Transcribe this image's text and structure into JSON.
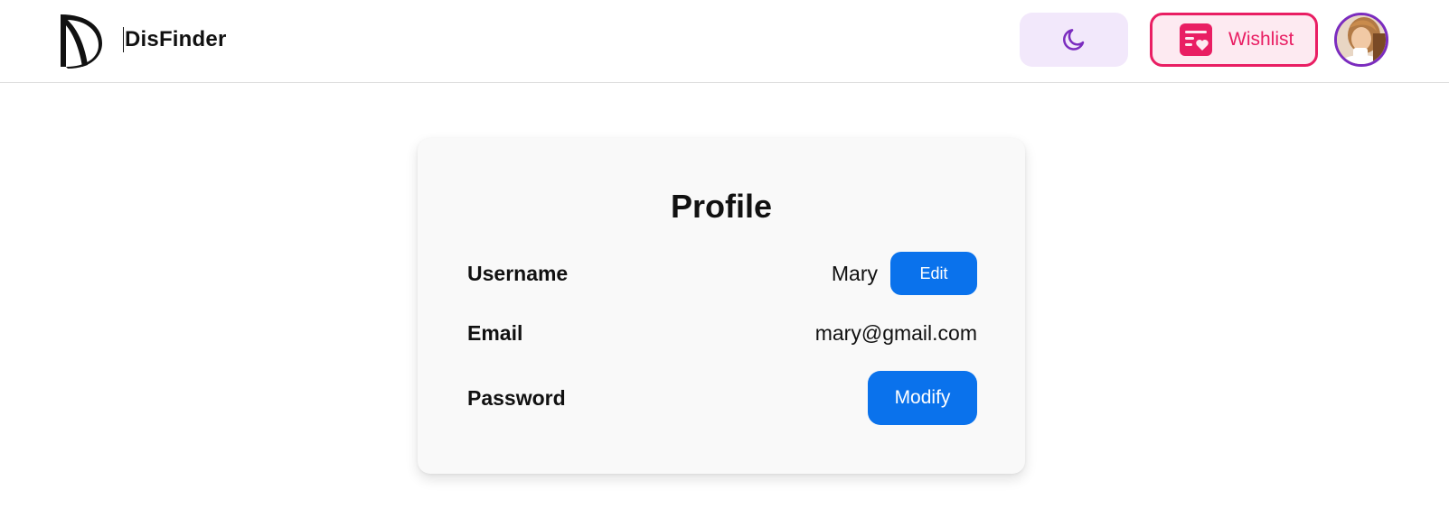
{
  "header": {
    "brand": "DisFinder",
    "theme_toggle_icon": "moon-icon",
    "wishlist": {
      "label": "Wishlist",
      "icon": "wishlist-heart-icon",
      "color": "#e91e63"
    },
    "avatar_icon": "user-avatar"
  },
  "profile": {
    "title": "Profile",
    "username": {
      "label": "Username",
      "value": "Mary",
      "action": "Edit"
    },
    "email": {
      "label": "Email",
      "value": "mary@gmail.com"
    },
    "password": {
      "label": "Password",
      "action": "Modify"
    }
  },
  "colors": {
    "primary_blue": "#0a72ec",
    "accent_purple": "#7b2cbf",
    "toggle_bg": "#f2e8fb",
    "wishlist_bg": "#fdeaf1"
  }
}
